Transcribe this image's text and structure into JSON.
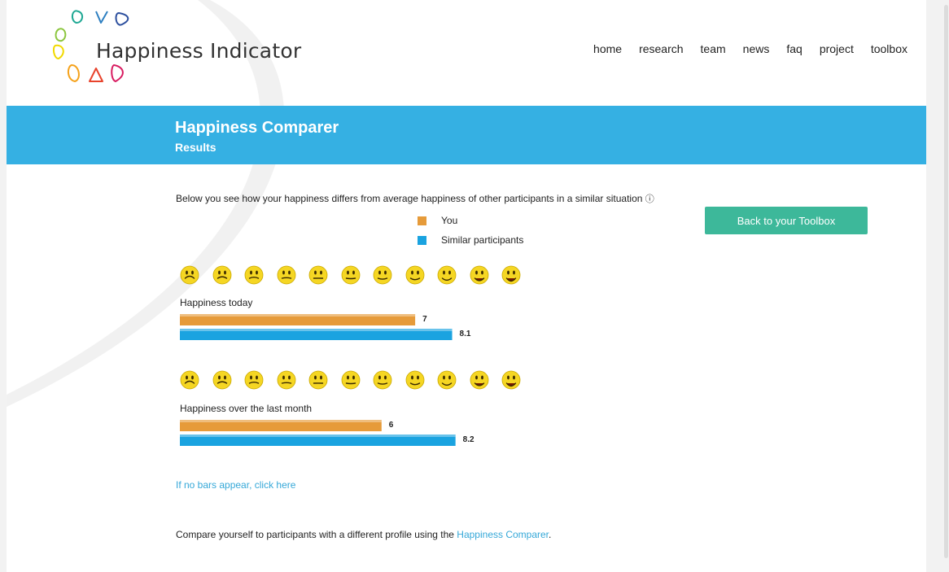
{
  "header": {
    "logo_text": "Happiness Indicator",
    "nav": [
      "home",
      "research",
      "team",
      "news",
      "faq",
      "project",
      "toolbox"
    ]
  },
  "banner": {
    "title": "Happiness Comparer",
    "subtitle": "Results",
    "color": "#35b0e3"
  },
  "intro": {
    "text": "Below you see how your happiness differs from average happiness of other participants in a similar situation",
    "info_icon": "ⓘ"
  },
  "legend": [
    {
      "label": "You",
      "color": "#e69b3a"
    },
    {
      "label": "Similar participants",
      "color": "#1aa3e0"
    }
  ],
  "back_button": {
    "label": "Back to your Toolbox",
    "color": "#3db89a"
  },
  "smiley_scale": {
    "count": 11,
    "icons": "sad-to-happy-face-icons"
  },
  "chart_data": [
    {
      "type": "bar",
      "orientation": "horizontal",
      "title": "Happiness today",
      "categories": [
        "You",
        "Similar participants"
      ],
      "values": [
        7,
        8.1
      ],
      "value_labels": [
        "7",
        "8.1"
      ],
      "xlim": [
        0,
        10
      ],
      "colors": [
        "#e69b3a",
        "#1aa3e0"
      ]
    },
    {
      "type": "bar",
      "orientation": "horizontal",
      "title": "Happiness over the last month",
      "categories": [
        "You",
        "Similar participants"
      ],
      "values": [
        6,
        8.2
      ],
      "value_labels": [
        "6",
        "8.2"
      ],
      "xlim": [
        0,
        10
      ],
      "colors": [
        "#e69b3a",
        "#1aa3e0"
      ]
    }
  ],
  "fallback_link": "If no bars appear, click here",
  "footer": {
    "text_before": "Compare yourself to participants with a different profile using the ",
    "link": "Happiness Comparer",
    "text_after": "."
  }
}
